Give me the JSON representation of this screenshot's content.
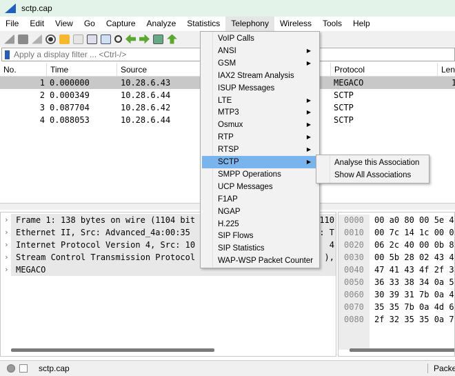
{
  "window": {
    "title": "sctp.cap"
  },
  "menubar": [
    "File",
    "Edit",
    "View",
    "Go",
    "Capture",
    "Analyze",
    "Statistics",
    "Telephony",
    "Wireless",
    "Tools",
    "Help"
  ],
  "filter": {
    "placeholder": "Apply a display filter ... <Ctrl-/>"
  },
  "packet_list": {
    "columns": [
      "No.",
      "Time",
      "Source",
      "Protocol",
      "Leng"
    ],
    "rows": [
      {
        "no": "1",
        "time": "0.000000",
        "source": "10.28.6.43",
        "protocol": "MEGACO",
        "length": "1"
      },
      {
        "no": "2",
        "time": "0.000349",
        "source": "10.28.6.44",
        "protocol": "SCTP",
        "length": ""
      },
      {
        "no": "3",
        "time": "0.087704",
        "source": "10.28.6.42",
        "protocol": "SCTP",
        "length": ""
      },
      {
        "no": "4",
        "time": "0.088053",
        "source": "10.28.6.44",
        "protocol": "SCTP",
        "length": ""
      }
    ]
  },
  "details": [
    {
      "left": "Frame 1: 138 bytes on wire (1104 bit",
      "right": "110"
    },
    {
      "left": "Ethernet II, Src: Advanced_4a:00:35",
      "right": ": T"
    },
    {
      "left": "Internet Protocol Version 4, Src: 10",
      "right": "4"
    },
    {
      "left": "Stream Control Transmission Protocol",
      "right": "),"
    },
    {
      "left": "MEGACO",
      "right": ""
    }
  ],
  "hex": [
    {
      "off": "0000",
      "bytes": "00 a0 80 00 5e 4"
    },
    {
      "off": "0010",
      "bytes": "00 7c 14 1c 00 0"
    },
    {
      "off": "0020",
      "bytes": "06 2c 40 00 0b 8"
    },
    {
      "off": "0030",
      "bytes": "00 5b 28 02 43 4"
    },
    {
      "off": "0040",
      "bytes": "47 41 43 4f 2f 3"
    },
    {
      "off": "0050",
      "bytes": "36 33 38 34 0a 5"
    },
    {
      "off": "0060",
      "bytes": "30 39 31 7b 0a 4"
    },
    {
      "off": "0070",
      "bytes": "35 35 7b 0a 4d 6"
    },
    {
      "off": "0080",
      "bytes": "2f 32 35 35 0a 7"
    }
  ],
  "status": {
    "file": "sctp.cap",
    "packets": "Packets"
  },
  "telephony_menu": [
    {
      "label": "VoIP Calls",
      "sub": false
    },
    {
      "label": "ANSI",
      "sub": true
    },
    {
      "label": "GSM",
      "sub": true
    },
    {
      "label": "IAX2 Stream Analysis",
      "sub": false
    },
    {
      "label": "ISUP Messages",
      "sub": false
    },
    {
      "label": "LTE",
      "sub": true
    },
    {
      "label": "MTP3",
      "sub": true
    },
    {
      "label": "Osmux",
      "sub": true
    },
    {
      "label": "RTP",
      "sub": true
    },
    {
      "label": "RTSP",
      "sub": true
    },
    {
      "label": "SCTP",
      "sub": true,
      "highlighted": true
    },
    {
      "label": "SMPP Operations",
      "sub": false
    },
    {
      "label": "UCP Messages",
      "sub": false
    },
    {
      "label": "F1AP",
      "sub": false
    },
    {
      "label": "NGAP",
      "sub": false
    },
    {
      "label": "H.225",
      "sub": false
    },
    {
      "label": "SIP Flows",
      "sub": false
    },
    {
      "label": "SIP Statistics",
      "sub": false
    },
    {
      "label": "WAP-WSP Packet Counter",
      "sub": false
    }
  ],
  "sctp_submenu": [
    "Analyse this Association",
    "Show All Associations"
  ],
  "colors": {
    "highlight": "#7ab4ec",
    "selected_row": "#c8c8c8",
    "titlebar": "#e4f3ea"
  }
}
